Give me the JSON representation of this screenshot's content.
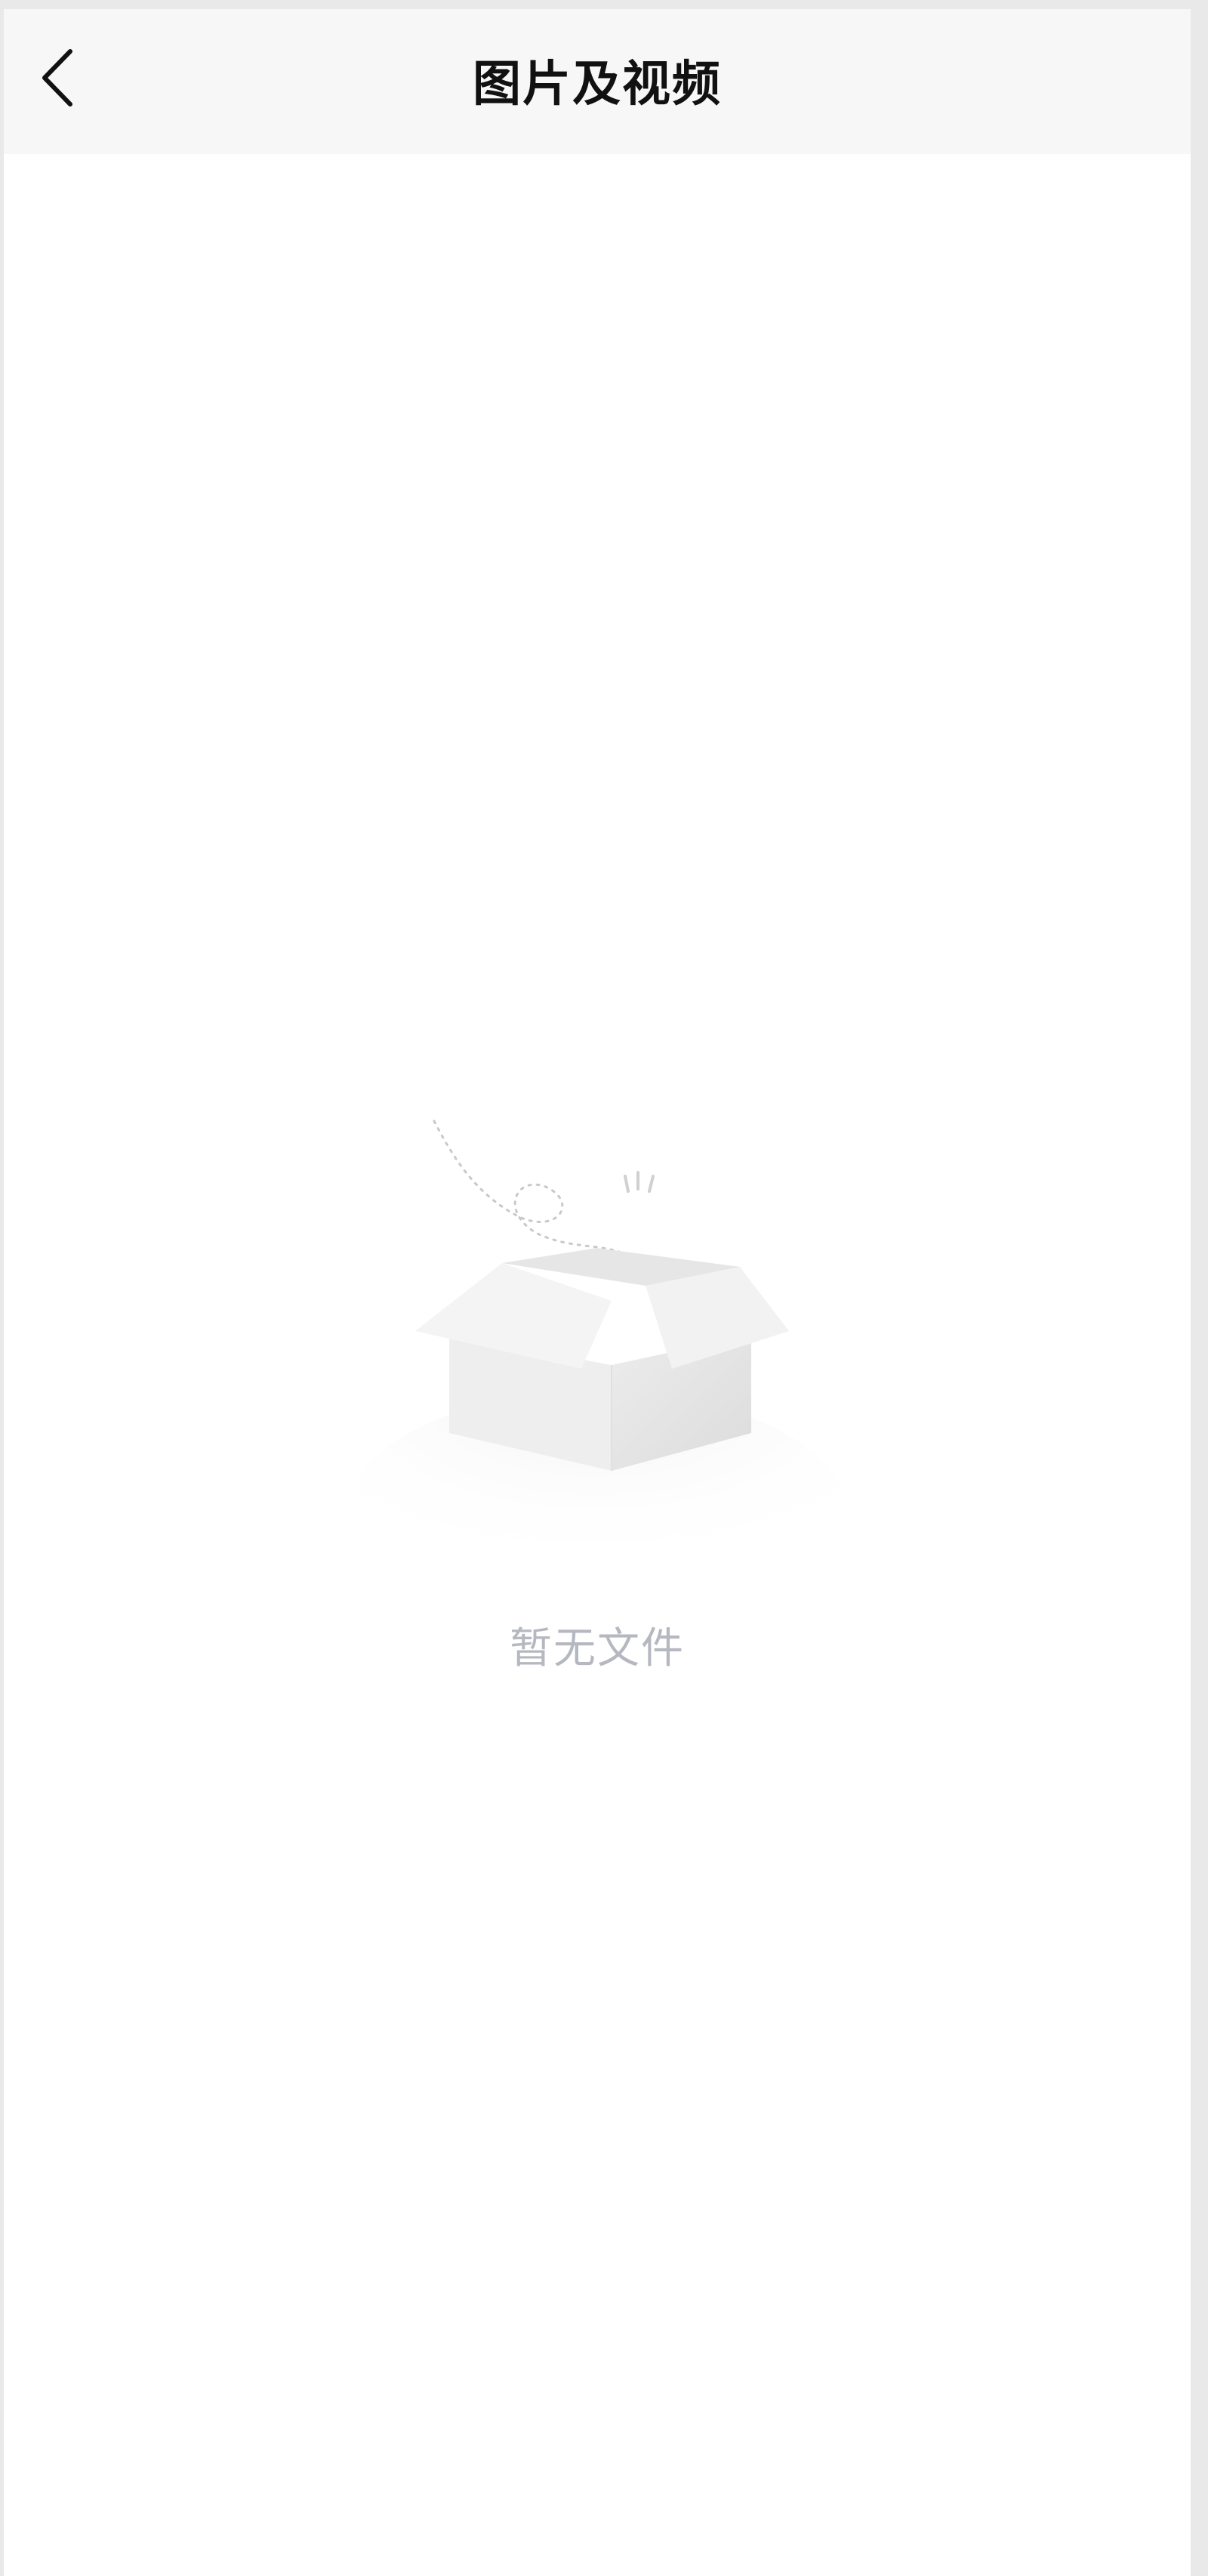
{
  "header": {
    "back_icon": "chevron-left-icon",
    "title": "图片及视频"
  },
  "empty_state": {
    "illustration_icon": "empty-open-box-icon",
    "message": "暂无文件"
  },
  "colors": {
    "navbar_background": "#f7f7f7",
    "page_background": "#ffffff",
    "title_text": "#111111",
    "empty_text": "#b5b8c0"
  }
}
